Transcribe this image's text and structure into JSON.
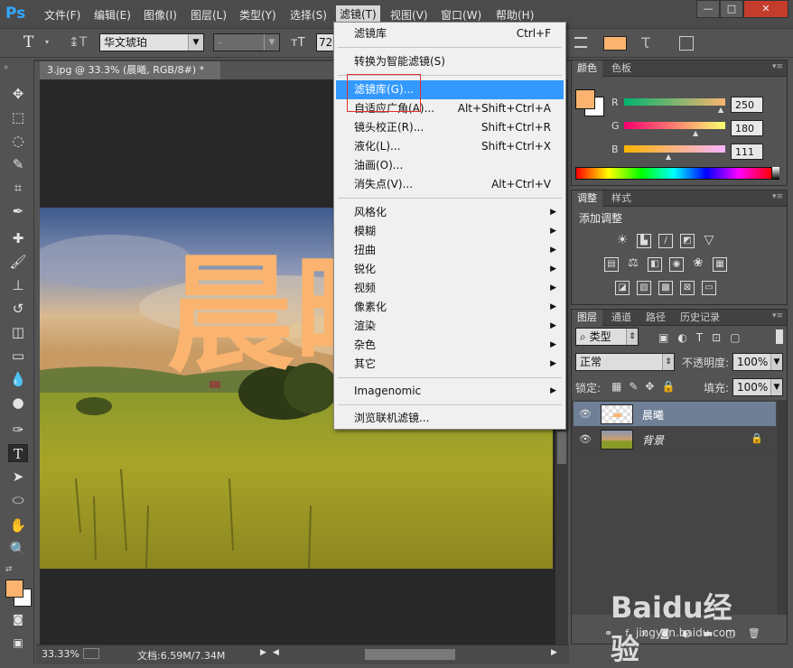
{
  "menubar": {
    "logo": "Ps",
    "items": [
      "文件(F)",
      "编辑(E)",
      "图像(I)",
      "图层(L)",
      "类型(Y)",
      "选择(S)",
      "滤镜(T)",
      "视图(V)",
      "窗口(W)",
      "帮助(H)"
    ],
    "window_buttons": [
      "—",
      "□",
      "✕"
    ]
  },
  "options": {
    "font_family": "华文琥珀",
    "font_style": "-",
    "font_size": "72"
  },
  "document": {
    "tab_title": "3.jpg @ 33.3% (晨曦, RGB/8#) *",
    "canvas_text": "晨曦",
    "zoom": "33.33%",
    "doc_info": "文档:6.59M/7.34M"
  },
  "filter_menu": {
    "items": [
      {
        "label": "滤镜库",
        "shortcut": "Ctrl+F"
      },
      {
        "label": "转换为智能滤镜(S)",
        "shortcut": ""
      },
      {
        "label": "滤镜库(G)...",
        "shortcut": ""
      },
      {
        "label": "自适应广角(A)...",
        "shortcut": "Alt+Shift+Ctrl+A"
      },
      {
        "label": "镜头校正(R)...",
        "shortcut": "Shift+Ctrl+R"
      },
      {
        "label": "液化(L)...",
        "shortcut": "Shift+Ctrl+X"
      },
      {
        "label": "油画(O)...",
        "shortcut": ""
      },
      {
        "label": "消失点(V)...",
        "shortcut": "Alt+Ctrl+V"
      },
      {
        "label": "风格化",
        "shortcut": ""
      },
      {
        "label": "模糊",
        "shortcut": ""
      },
      {
        "label": "扭曲",
        "shortcut": ""
      },
      {
        "label": "锐化",
        "shortcut": ""
      },
      {
        "label": "视频",
        "shortcut": ""
      },
      {
        "label": "像素化",
        "shortcut": ""
      },
      {
        "label": "渲染",
        "shortcut": ""
      },
      {
        "label": "杂色",
        "shortcut": ""
      },
      {
        "label": "其它",
        "shortcut": ""
      },
      {
        "label": "Imagenomic",
        "shortcut": ""
      },
      {
        "label": "浏览联机滤镜...",
        "shortcut": ""
      }
    ]
  },
  "color_panel": {
    "tabs": [
      "颜色",
      "色板"
    ],
    "channels": [
      {
        "name": "R",
        "value": "250"
      },
      {
        "name": "G",
        "value": "180"
      },
      {
        "name": "B",
        "value": "111"
      }
    ],
    "foreground": "#fab46f"
  },
  "adjust_panel": {
    "tabs": [
      "调整",
      "样式"
    ],
    "title": "添加调整"
  },
  "layers_panel": {
    "tabs": [
      "图层",
      "通道",
      "路径",
      "历史记录"
    ],
    "filter_kind": "类型",
    "blend_mode": "正常",
    "opacity_label": "不透明度:",
    "opacity": "100%",
    "lock_label": "锁定:",
    "fill_label": "填充:",
    "fill": "100%",
    "layers": [
      {
        "name": "晨曦"
      },
      {
        "name": "背景"
      }
    ]
  },
  "watermark": {
    "brand": "Baidu经验",
    "url": "jingyan.baidu.com"
  }
}
